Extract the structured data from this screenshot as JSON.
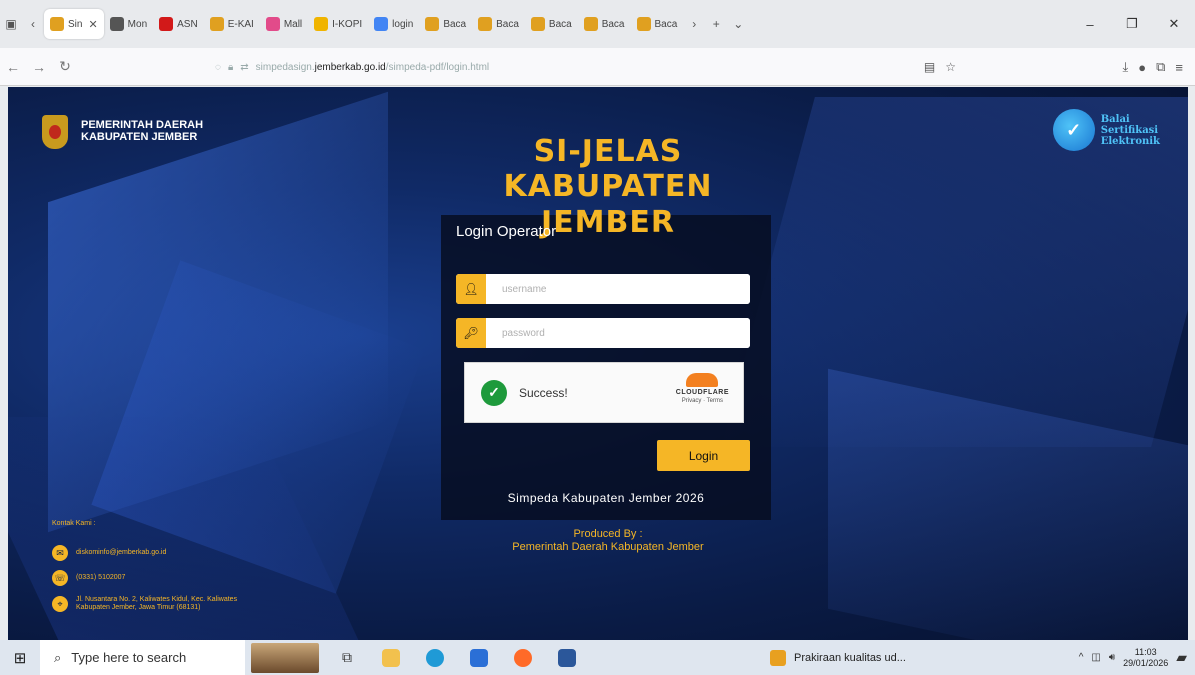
{
  "browser": {
    "tabs": [
      {
        "label": "Sin",
        "color": "#e0a020",
        "active": true
      },
      {
        "label": "Mon",
        "color": "#555555",
        "active": false
      },
      {
        "label": "ASN",
        "color": "#d21919",
        "active": false
      },
      {
        "label": "E-KAI",
        "color": "#e0a020",
        "active": false
      },
      {
        "label": "Mall",
        "color": "#e24b8a",
        "active": false
      },
      {
        "label": "I-KOPI",
        "color": "#f0b400",
        "active": false
      },
      {
        "label": "login",
        "color": "#4285f4",
        "active": false
      },
      {
        "label": "Baca",
        "color": "#e0a020",
        "active": false
      },
      {
        "label": "Baca",
        "color": "#e0a020",
        "active": false
      },
      {
        "label": "Baca",
        "color": "#e0a020",
        "active": false
      },
      {
        "label": "Baca",
        "color": "#e0a020",
        "active": false
      },
      {
        "label": "Baca",
        "color": "#e0a020",
        "active": false
      }
    ],
    "url_prefix": "simpedasign.",
    "url_host": "jemberkab.go.id",
    "url_path": "/simpeda-pdf/login.html"
  },
  "header": {
    "gov_line1": "PEMERINTAH DAERAH",
    "gov_line2": "KABUPATEN JEMBER",
    "bsre_line1": "Balai",
    "bsre_line2": "Sertifikasi",
    "bsre_line3": "Elektronik"
  },
  "login": {
    "title_line1": "SI-JELAS",
    "title_line2": "KABUPATEN JEMBER",
    "heading": "Login Operator",
    "username_placeholder": "username",
    "password_placeholder": "password",
    "captcha_status": "Success!",
    "captcha_brand": "CLOUDFLARE",
    "captcha_links": "Privacy · Terms",
    "button_label": "Login",
    "footer": "Simpeda Kabupaten Jember 2026"
  },
  "produced": {
    "line1": "Produced By :",
    "line2": "Pemerintah Daerah Kabupaten Jember"
  },
  "contact": {
    "heading": "Kontak Kami :",
    "email": "diskominfo@jemberkab.go.id",
    "phone": "(0331) 5102007",
    "address_line1": "Jl. Nusantara No. 2, Kaliwates Kidul, Kec. Kaliwates",
    "address_line2": "Kabupaten Jember, Jawa Timur (68131)"
  },
  "taskbar": {
    "search_placeholder": "Type here to search",
    "task_label": "Prakiraan kualitas ud...",
    "time": "11:03",
    "date": "29/01/2026"
  }
}
